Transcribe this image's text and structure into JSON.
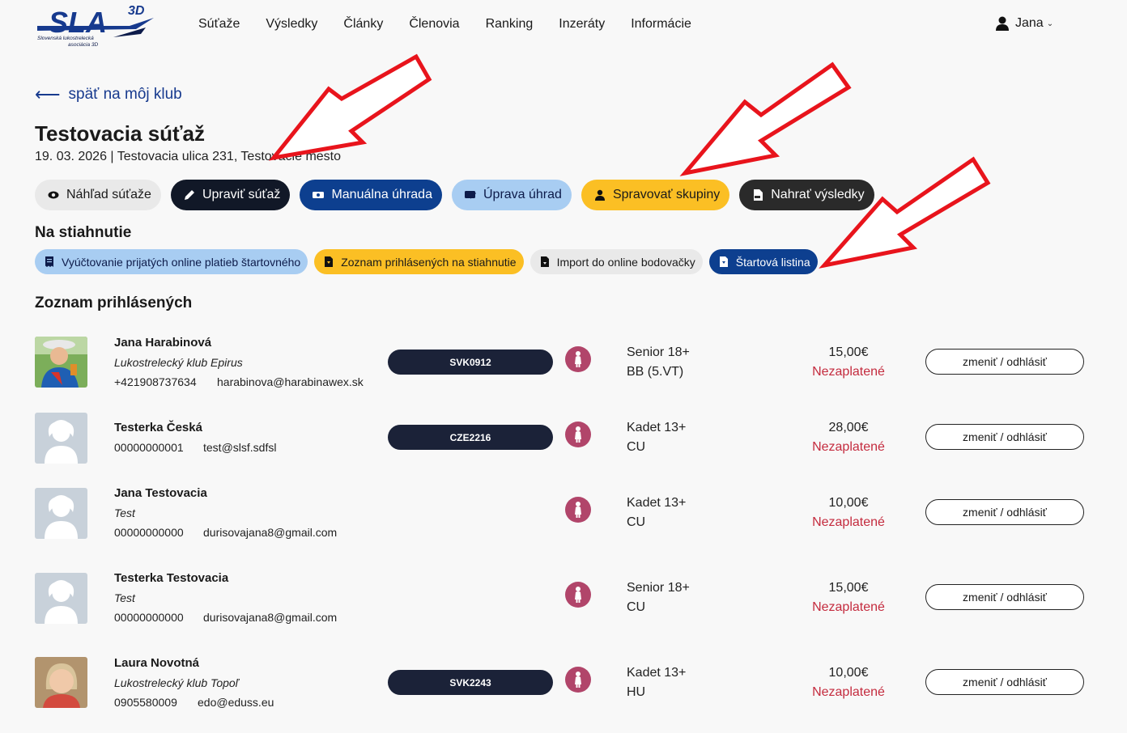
{
  "header": {
    "logo_text": "SLA",
    "logo_3d": "3D",
    "logo_sub_1": "Slovenská lukostrelecká",
    "logo_sub_2": "asociácia 3D",
    "nav": [
      "Súťaže",
      "Výsledky",
      "Články",
      "Členovia",
      "Ranking",
      "Inzeráty",
      "Informácie"
    ],
    "user_name": "Jana"
  },
  "back_link": "späť na môj klub",
  "competition": {
    "title": "Testovacia súťaž",
    "subtitle": "19. 03. 2026 | Testovacia ulica 231, Testovacie mesto"
  },
  "actions": {
    "preview": "Náhľad súťaže",
    "edit": "Upraviť súťaž",
    "manual_payment": "Manuálna úhrada",
    "edit_payments": "Úprava úhrad",
    "manage_groups": "Spravovať skupiny",
    "upload_results": "Nahrať výsledky"
  },
  "downloads": {
    "heading": "Na stiahnutie",
    "billing": "Vyúčtovanie prijatých online platieb štartovného",
    "registered_list": "Zoznam prihlásených na stiahnutie",
    "import": "Import do online bodovačky",
    "start_list": "Štartová listina"
  },
  "registered": {
    "heading": "Zoznam prihlásených",
    "change_label": "zmeniť / odhlásiť",
    "rows": [
      {
        "name": "Jana Harabinová",
        "club": "Lukostrelecký klub Epirus",
        "phone": "+421908737634",
        "email": "harabinova@harabinawex.sk",
        "license": "SVK0912",
        "category": "Senior 18+",
        "division": "BB (5.VT)",
        "price": "15,00€",
        "status": "Nezaplatené",
        "avatar": "photo"
      },
      {
        "name": "Testerka Česká",
        "club": "",
        "phone": "00000000001",
        "email": "test@slsf.sdfsl",
        "license": "CZE2216",
        "category": "Kadet 13+",
        "division": "CU",
        "price": "28,00€",
        "status": "Nezaplatené",
        "avatar": "placeholder"
      },
      {
        "name": "Jana Testovacia",
        "club": "Test",
        "phone": "00000000000",
        "email": "durisovajana8@gmail.com",
        "license": "",
        "category": "Kadet 13+",
        "division": "CU",
        "price": "10,00€",
        "status": "Nezaplatené",
        "avatar": "placeholder"
      },
      {
        "name": "Testerka Testovacia",
        "club": "Test",
        "phone": "00000000000",
        "email": "durisovajana8@gmail.com",
        "license": "",
        "category": "Senior 18+",
        "division": "CU",
        "price": "15,00€",
        "status": "Nezaplatené",
        "avatar": "placeholder"
      },
      {
        "name": "Laura Novotná",
        "club": "Lukostrelecký klub Topoľ",
        "phone": "0905580009",
        "email": "edo@eduss.eu",
        "license": "SVK2243",
        "category": "Kadet 13+",
        "division": "HU",
        "price": "10,00€",
        "status": "Nezaplatené",
        "avatar": "photo"
      }
    ]
  },
  "colors": {
    "accent_navy": "#0d3f8f",
    "unpaid_red": "#c42b3e",
    "annotation_arrow": "#e8141c",
    "yellow": "#fbbf24"
  }
}
